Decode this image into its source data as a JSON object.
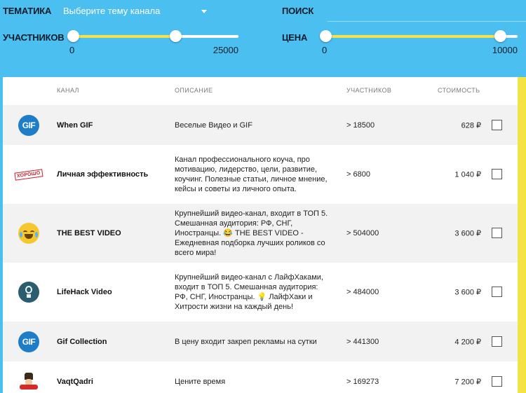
{
  "filters": {
    "theme_label": "ТЕМАТИКА",
    "theme_select_value": "Выберите тему канала",
    "search_label": "ПОИСК",
    "search_value": "",
    "members_label": "УЧАСТНИКОВ",
    "members_slider": {
      "min_label": "0",
      "max_label": "25000",
      "low_fraction": 0.0,
      "high_fraction": 0.62
    },
    "price_label": "ЦЕНА",
    "price_slider": {
      "min_label": "0",
      "max_label": "10000",
      "low_fraction": 0.0,
      "high_fraction": 0.91
    }
  },
  "colors": {
    "header_bg": "#4bbff0",
    "accent_yellow": "#f3e346",
    "row_alt_bg": "#f2f2f2"
  },
  "table": {
    "headers": {
      "channel": "КАНАЛ",
      "description": "ОПИСАНИЕ",
      "members": "УЧАСТНИКОВ",
      "cost": "СТОИМОСТЬ"
    },
    "rows": [
      {
        "icon": "gif-icon",
        "icon_text": "GIF",
        "name": "When GIF",
        "description": "Веселые Видео и GIF",
        "members": "> 18500",
        "price": "628 ₽"
      },
      {
        "icon": "stamp-icon",
        "icon_text": "ХОРОШО",
        "name": "Личная эффективность",
        "description": "Канал профессионального коуча, про мотивацию, лидерство, цели, развитие, коучинг. Полезные статьи, личное мнение, кейсы и советы из личного опыта.",
        "members": "> 6800",
        "price": "1 040 ₽"
      },
      {
        "icon": "laughing-emoji-icon",
        "name": "THE BEST VIDEO",
        "description": "Крупнейший видео-канал, входит в ТОП 5. Смешанная аудитория: РФ, СНГ, Иностранцы. 😂 THE BEST VIDEO - Ежедневная подборка лучших роликов со всего мира!",
        "members": "> 504000",
        "price": "3 600 ₽"
      },
      {
        "icon": "lightbulb-icon",
        "name": "LifeHack Video",
        "description": "Крупнейший видео-канал с ЛайфХаками, входит в ТОП 5. Смешанная аудитория: РФ, СНГ, Иностранцы. 💡 ЛайфХаки и Хитрости жизни на каждый день!",
        "members": "> 484000",
        "price": "3 600 ₽"
      },
      {
        "icon": "gif-icon",
        "icon_text": "GIF",
        "name": "Gif Collection",
        "description": "В цену входит закреп рекламы на сутки",
        "members": "> 441300",
        "price": "4 200 ₽"
      },
      {
        "icon": "vaqtqadri-logo-icon",
        "name": "VaqtQadri",
        "description": "Цените время",
        "members": "> 169273",
        "price": "7 200 ₽"
      }
    ]
  }
}
